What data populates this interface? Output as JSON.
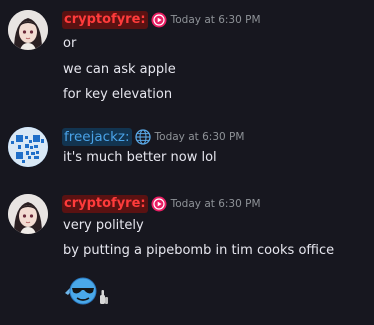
{
  "messages": [
    {
      "username": "cryptofyre:",
      "timestamp": "Today at 6:30 PM",
      "lines": [
        "or",
        "we can ask apple",
        "for key elevation"
      ]
    },
    {
      "username": "freejackz:",
      "timestamp": "Today at 6:30 PM",
      "lines": [
        "it's much better now lol"
      ]
    },
    {
      "username": "cryptofyre:",
      "timestamp": "Today at 6:30 PM",
      "lines": [
        "very politely",
        "by putting a pipebomb in tim cooks office"
      ]
    }
  ],
  "icons": {
    "badge_1": "play-circle-icon",
    "badge_2": "globe-icon",
    "badge_3": "play-circle-icon",
    "emoji": "cool-emoji-sunglasses-thumbsup"
  },
  "colors": {
    "background": "#17171f",
    "username_red": "#ff3b3b",
    "username_red_bg": "#5a1212",
    "username_blue": "#4aa3e8",
    "username_blue_bg": "#123450",
    "badge_pink": "#e91e63",
    "timestamp": "#8e9297",
    "text": "#e6e6ee"
  }
}
